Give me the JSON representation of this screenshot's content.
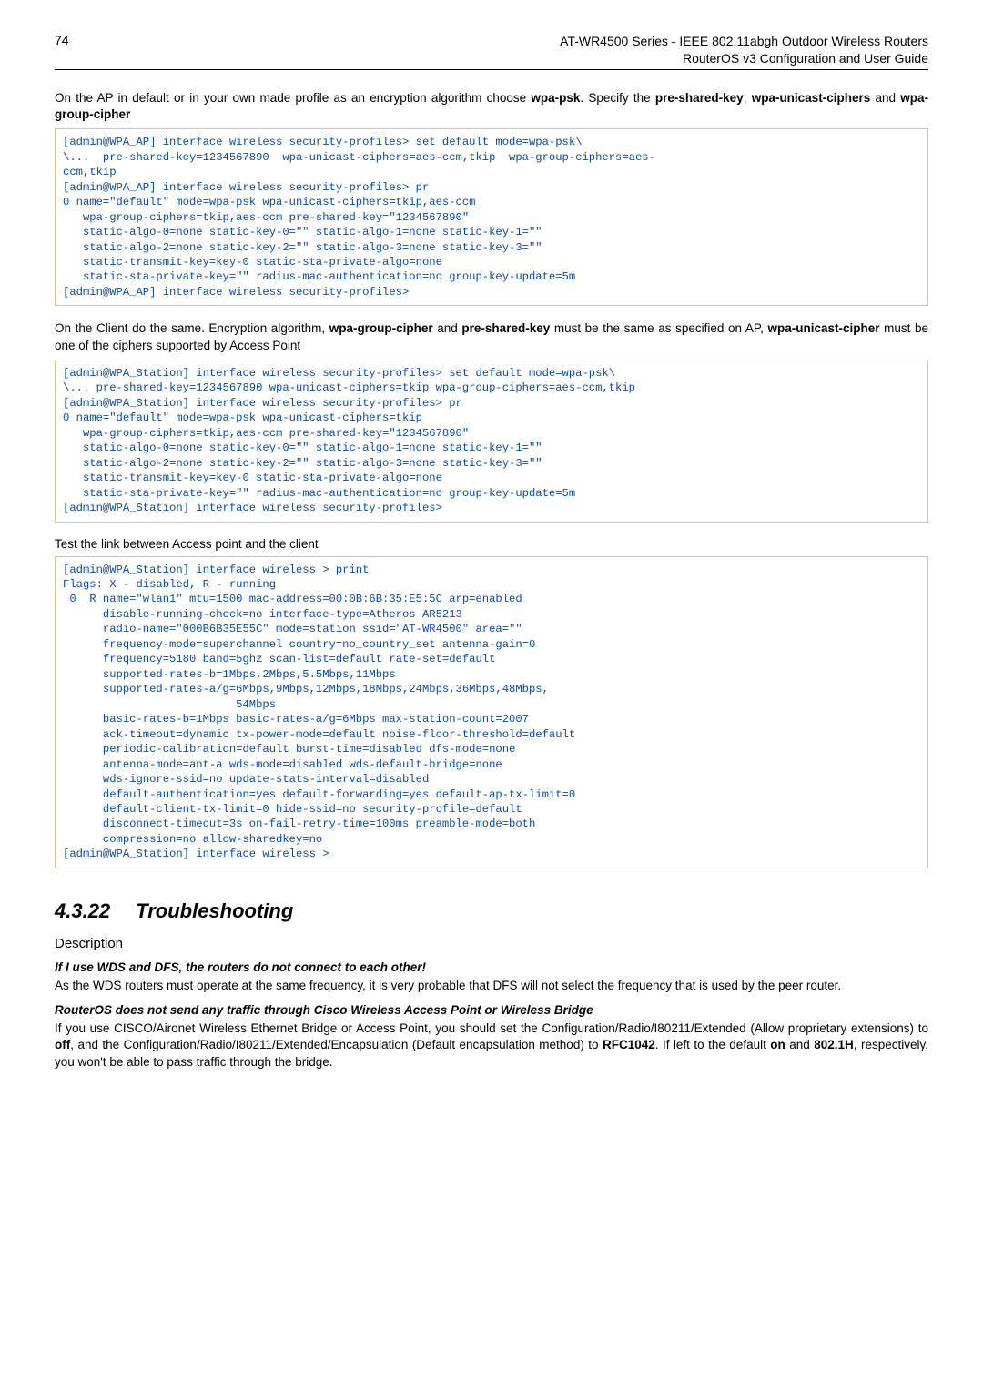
{
  "header": {
    "page_number": "74",
    "title_line1": "AT-WR4500 Series - IEEE 802.11abgh Outdoor Wireless Routers",
    "title_line2": "RouterOS v3 Configuration and User Guide"
  },
  "para1_a": "On the AP in default or in your own made profile as an encryption algorithm choose ",
  "para1_b": "wpa-psk",
  "para1_c": ". Specify the ",
  "para1_d": "pre-shared-key",
  "para1_e": ", ",
  "para1_f": "wpa-unicast-ciphers",
  "para1_g": " and ",
  "para1_h": "wpa-group-cipher",
  "code1": "[admin@WPA_AP] interface wireless security-profiles> set default mode=wpa-psk\\\n\\...  pre-shared-key=1234567890  wpa-unicast-ciphers=aes-ccm,tkip  wpa-group-ciphers=aes-\nccm,tkip\n[admin@WPA_AP] interface wireless security-profiles> pr\n0 name=\"default\" mode=wpa-psk wpa-unicast-ciphers=tkip,aes-ccm\n   wpa-group-ciphers=tkip,aes-ccm pre-shared-key=\"1234567890\"\n   static-algo-0=none static-key-0=\"\" static-algo-1=none static-key-1=\"\"\n   static-algo-2=none static-key-2=\"\" static-algo-3=none static-key-3=\"\"\n   static-transmit-key=key-0 static-sta-private-algo=none\n   static-sta-private-key=\"\" radius-mac-authentication=no group-key-update=5m\n[admin@WPA_AP] interface wireless security-profiles>",
  "para2_a": "On the Client do the same. Encryption algorithm, ",
  "para2_b": "wpa-group-cipher",
  "para2_c": " and ",
  "para2_d": "pre-shared-key",
  "para2_e": " must be the same as specified on AP, ",
  "para2_f": "wpa-unicast-cipher",
  "para2_g": " must be one of the ciphers supported by Access Point",
  "code2": "[admin@WPA_Station] interface wireless security-profiles> set default mode=wpa-psk\\\n\\... pre-shared-key=1234567890 wpa-unicast-ciphers=tkip wpa-group-ciphers=aes-ccm,tkip\n[admin@WPA_Station] interface wireless security-profiles> pr\n0 name=\"default\" mode=wpa-psk wpa-unicast-ciphers=tkip\n   wpa-group-ciphers=tkip,aes-ccm pre-shared-key=\"1234567890\"\n   static-algo-0=none static-key-0=\"\" static-algo-1=none static-key-1=\"\"\n   static-algo-2=none static-key-2=\"\" static-algo-3=none static-key-3=\"\"\n   static-transmit-key=key-0 static-sta-private-algo=none\n   static-sta-private-key=\"\" radius-mac-authentication=no group-key-update=5m\n[admin@WPA_Station] interface wireless security-profiles>",
  "caption3": "Test the link between Access point and the client",
  "code3": "[admin@WPA_Station] interface wireless > print\nFlags: X - disabled, R - running\n 0  R name=\"wlan1\" mtu=1500 mac-address=00:0B:6B:35:E5:5C arp=enabled\n      disable-running-check=no interface-type=Atheros AR5213\n      radio-name=\"000B6B35E55C\" mode=station ssid=\"AT-WR4500\" area=\"\"\n      frequency-mode=superchannel country=no_country_set antenna-gain=0\n      frequency=5180 band=5ghz scan-list=default rate-set=default\n      supported-rates-b=1Mbps,2Mbps,5.5Mbps,11Mbps\n      supported-rates-a/g=6Mbps,9Mbps,12Mbps,18Mbps,24Mbps,36Mbps,48Mbps,\n                          54Mbps\n      basic-rates-b=1Mbps basic-rates-a/g=6Mbps max-station-count=2007\n      ack-timeout=dynamic tx-power-mode=default noise-floor-threshold=default\n      periodic-calibration=default burst-time=disabled dfs-mode=none\n      antenna-mode=ant-a wds-mode=disabled wds-default-bridge=none\n      wds-ignore-ssid=no update-stats-interval=disabled\n      default-authentication=yes default-forwarding=yes default-ap-tx-limit=0\n      default-client-tx-limit=0 hide-ssid=no security-profile=default\n      disconnect-timeout=3s on-fail-retry-time=100ms preamble-mode=both\n      compression=no allow-sharedkey=no\n[admin@WPA_Station] interface wireless >",
  "section": {
    "number": "4.3.22",
    "title": "Troubleshooting"
  },
  "desc_heading": "Description",
  "sub1": "If I use WDS and DFS, the routers do not connect to each other!",
  "para3": "As the WDS routers must operate at the same frequency, it is very probable that DFS will not select the frequency that is used by the peer router.",
  "sub2": "RouterOS does not send any traffic through Cisco Wireless Access Point or Wireless Bridge",
  "para4_a": "If you use CISCO/Aironet Wireless Ethernet Bridge or Access Point, you should set the Configuration/Radio/I80211/Extended (Allow proprietary extensions) to ",
  "para4_b": "off",
  "para4_c": ", and the Configuration/Radio/I80211/Extended/Encapsulation (Default encapsulation method) to ",
  "para4_d": "RFC1042",
  "para4_e": ". If left to the default ",
  "para4_f": "on",
  "para4_g": " and ",
  "para4_h": "802.1H",
  "para4_i": ", respectively, you won't be able to pass traffic through the bridge."
}
